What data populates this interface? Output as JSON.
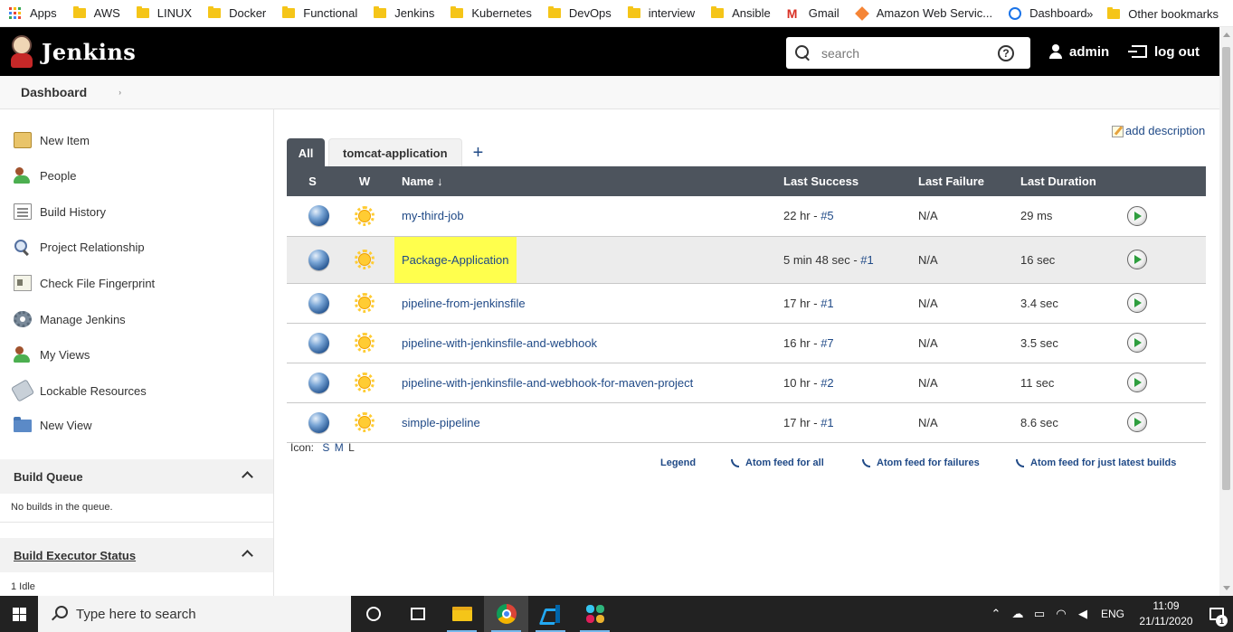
{
  "bookmarks": {
    "items": [
      {
        "label": "Apps",
        "icon": "apps-grid-icon"
      },
      {
        "label": "AWS",
        "icon": "folder-icon"
      },
      {
        "label": "LINUX",
        "icon": "folder-icon"
      },
      {
        "label": "Docker",
        "icon": "folder-icon"
      },
      {
        "label": "Functional",
        "icon": "folder-icon"
      },
      {
        "label": "Jenkins",
        "icon": "folder-icon"
      },
      {
        "label": "Kubernetes",
        "icon": "folder-icon"
      },
      {
        "label": "DevOps",
        "icon": "folder-icon"
      },
      {
        "label": "interview",
        "icon": "folder-icon"
      },
      {
        "label": "Ansible",
        "icon": "folder-icon"
      },
      {
        "label": "Gmail",
        "icon": "gmail-icon"
      },
      {
        "label": "Amazon Web Servic...",
        "icon": "aws-icon"
      },
      {
        "label": "Dashboard",
        "icon": "dashboard-icon"
      }
    ],
    "more": "»",
    "other": "Other bookmarks"
  },
  "header": {
    "title": "Jenkins",
    "search_placeholder": "search",
    "help": "?",
    "user": "admin",
    "logout": "log out"
  },
  "breadcrumb": {
    "dashboard": "Dashboard",
    "chevron": "›"
  },
  "sidebar": {
    "items": [
      {
        "label": "New Item",
        "icon": "new-item-icon"
      },
      {
        "label": "People",
        "icon": "people-icon"
      },
      {
        "label": "Build History",
        "icon": "build-history-icon"
      },
      {
        "label": "Project Relationship",
        "icon": "magnifier-icon"
      },
      {
        "label": "Check File Fingerprint",
        "icon": "fingerprint-icon"
      },
      {
        "label": "Manage Jenkins",
        "icon": "gear-icon"
      },
      {
        "label": "My Views",
        "icon": "people-icon"
      },
      {
        "label": "Lockable Resources",
        "icon": "lock-icon"
      },
      {
        "label": "New View",
        "icon": "folder-icon"
      }
    ],
    "build_queue": {
      "title": "Build Queue",
      "text": "No builds in the queue."
    },
    "executor": {
      "title": "Build Executor Status",
      "text": "1  Idle"
    }
  },
  "main": {
    "add_description": "add description",
    "tabs": [
      {
        "label": "All"
      },
      {
        "label": "tomcat-application"
      }
    ],
    "add_tab": "+",
    "columns": {
      "s": "S",
      "w": "W",
      "name": "Name ↓",
      "last_success": "Last Success",
      "last_failure": "Last Failure",
      "last_duration": "Last Duration"
    },
    "jobs": [
      {
        "name": "my-third-job",
        "success_time": "22 hr - ",
        "success_build": "#5",
        "failure": "N/A",
        "duration": "29 ms"
      },
      {
        "name": "Package-Application",
        "success_time": "5 min 48 sec - ",
        "success_build": "#1",
        "failure": "N/A",
        "duration": "16 sec"
      },
      {
        "name": "pipeline-from-jenkinsfile",
        "success_time": "17 hr - ",
        "success_build": "#1",
        "failure": "N/A",
        "duration": "3.4 sec"
      },
      {
        "name": "pipeline-with-jenkinsfile-and-webhook",
        "success_time": "16 hr - ",
        "success_build": "#7",
        "failure": "N/A",
        "duration": "3.5 sec"
      },
      {
        "name": "pipeline-with-jenkinsfile-and-webhook-for-maven-project",
        "success_time": "10 hr - ",
        "success_build": "#2",
        "failure": "N/A",
        "duration": "11 sec"
      },
      {
        "name": "simple-pipeline",
        "success_time": "17 hr - ",
        "success_build": "#1",
        "failure": "N/A",
        "duration": "8.6 sec"
      }
    ],
    "icon_size": {
      "label": "Icon:",
      "s": "S",
      "m": "M",
      "l": "L"
    },
    "feeds": {
      "legend": "Legend",
      "all": "Atom feed for all",
      "failures": "Atom feed for failures",
      "latest": "Atom feed for just latest builds"
    }
  },
  "taskbar": {
    "search_placeholder": "Type here to search",
    "lang": "ENG",
    "time": "11:09",
    "date": "21/11/2020",
    "notifications": "1"
  },
  "colors": {
    "header": "#000000",
    "table_header": "#4d545d",
    "link": "#204a87",
    "highlight": "#ffff4d"
  }
}
